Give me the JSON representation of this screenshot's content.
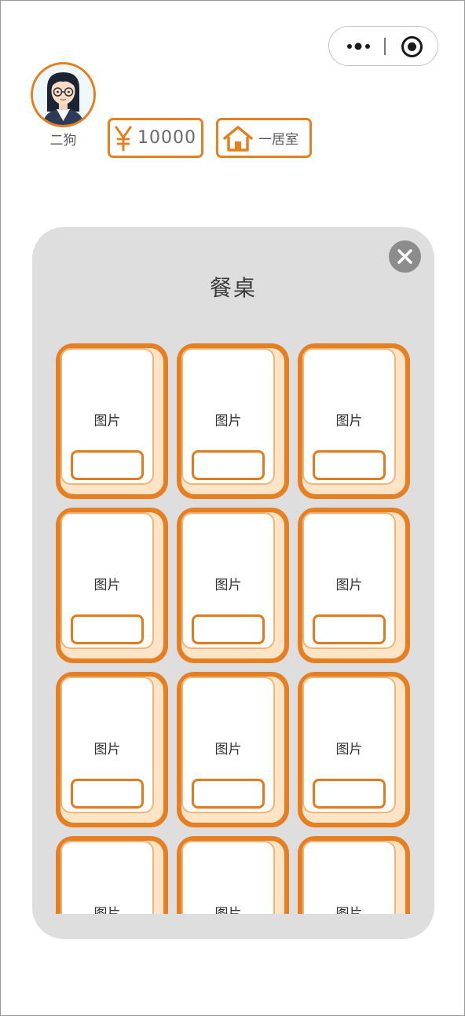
{
  "user": {
    "name": "二狗"
  },
  "wallet": {
    "amount": "10000"
  },
  "housing": {
    "label": "一居室"
  },
  "modal": {
    "title": "餐桌",
    "items": [
      {
        "label": "图片"
      },
      {
        "label": "图片"
      },
      {
        "label": "图片"
      },
      {
        "label": "图片"
      },
      {
        "label": "图片"
      },
      {
        "label": "图片"
      },
      {
        "label": "图片"
      },
      {
        "label": "图片"
      },
      {
        "label": "图片"
      },
      {
        "label": "图片"
      },
      {
        "label": "图片"
      },
      {
        "label": "图片"
      }
    ]
  },
  "icons": {
    "capsule_more": "more-dots-icon",
    "capsule_close": "target-circle-icon",
    "money": "yen-icon",
    "housing": "house-icon",
    "close": "close-icon"
  },
  "colors": {
    "accent": "#e6801f",
    "panel": "#dedede",
    "close_button": "#8c8c8c"
  }
}
